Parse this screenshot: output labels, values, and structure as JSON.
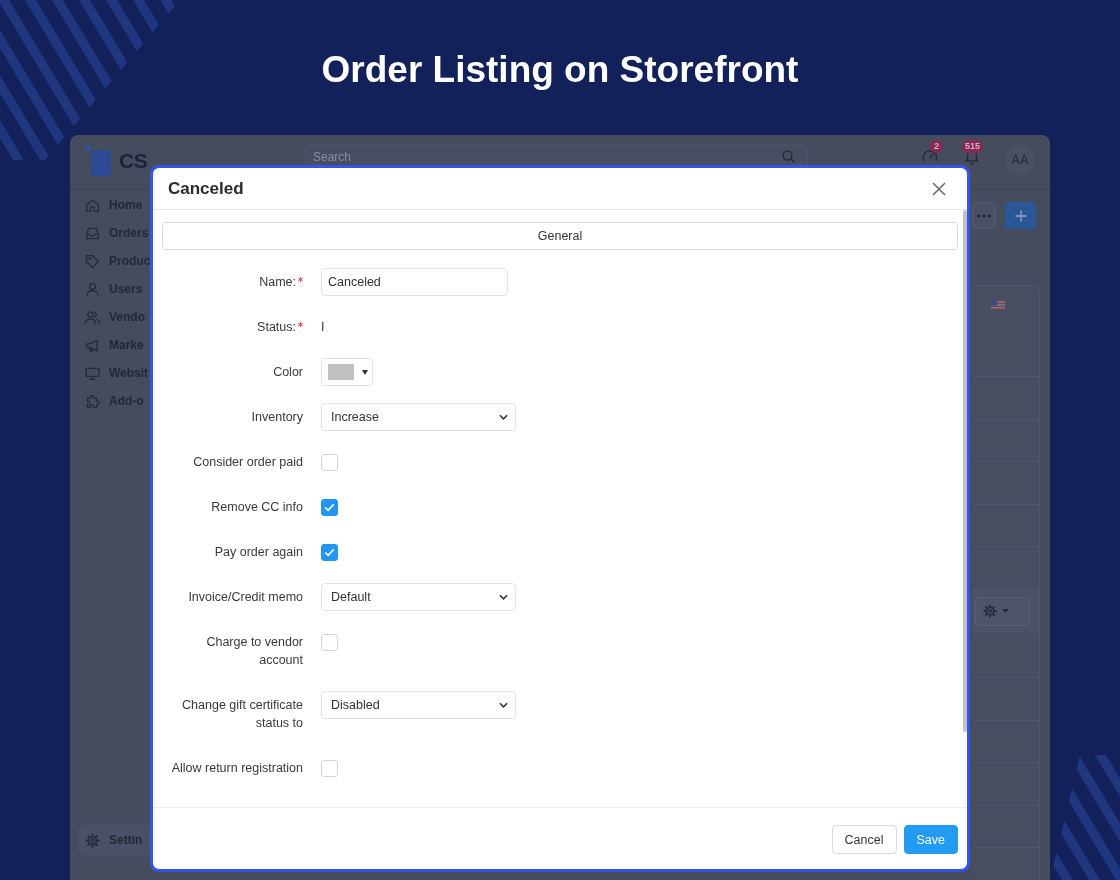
{
  "title": "Order Listing on Storefront",
  "app": {
    "logo": {
      "text": "CS"
    },
    "search": {
      "placeholder": "Search"
    },
    "notifications": [
      {
        "badge": "2"
      },
      {
        "badge": "515"
      }
    ],
    "avatar": {
      "initials": "AA"
    },
    "sidebar": {
      "items": [
        {
          "label": "Home"
        },
        {
          "label": "Orders"
        },
        {
          "label": "Produc"
        },
        {
          "label": "Users"
        },
        {
          "label": "Vendo"
        },
        {
          "label": "Marke"
        },
        {
          "label": "Websit"
        },
        {
          "label": "Add-o"
        }
      ],
      "settings": {
        "label": "Settin"
      }
    }
  },
  "modal": {
    "title": "Canceled",
    "tabs": [
      {
        "label": "General",
        "selected": true
      }
    ],
    "fields": [
      {
        "kind": "input",
        "label": "Name:",
        "required": true,
        "value": "Canceled"
      },
      {
        "kind": "text",
        "label": "Status:",
        "required": true,
        "value": "I"
      },
      {
        "kind": "color",
        "label": "Color",
        "required": false,
        "color": "#c0c0c0"
      },
      {
        "kind": "select",
        "label": "Inventory",
        "required": false,
        "value": "Increase"
      },
      {
        "kind": "checkbox",
        "label": "Consider order paid",
        "required": false,
        "checked": false
      },
      {
        "kind": "checkbox",
        "label": "Remove CC info",
        "required": false,
        "checked": true
      },
      {
        "kind": "checkbox",
        "label": "Pay order again",
        "required": false,
        "checked": true
      },
      {
        "kind": "select",
        "label": "Invoice/Credit memo",
        "required": false,
        "value": "Default"
      },
      {
        "kind": "checkbox",
        "label": "Charge to vendor account",
        "required": false,
        "checked": false
      },
      {
        "kind": "select",
        "label": "Change gift certificate status to",
        "required": false,
        "value": "Disabled"
      },
      {
        "kind": "checkbox",
        "label": "Allow return registration",
        "required": false,
        "checked": false
      }
    ],
    "buttons": [
      {
        "label": "Cancel",
        "kind": "secondary"
      },
      {
        "label": "Save",
        "kind": "primary"
      }
    ]
  }
}
